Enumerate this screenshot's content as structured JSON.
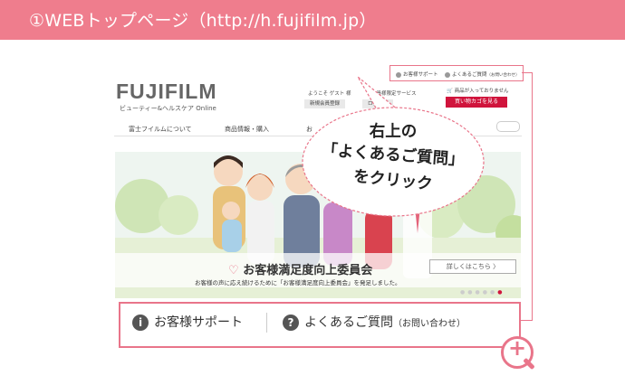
{
  "header": {
    "title": "①WEBトップページ（http://h.fujifilm.jp）"
  },
  "site": {
    "logo": "FUJIFILM",
    "logo_sub": "ビューティー&ヘルスケア Online",
    "util_support": "お客様サポート",
    "util_faq": "よくあるご質問",
    "util_faq_small": "（お問い合わせ）",
    "welcome": "ようこそ ゲスト 様",
    "member_service": "会員様限定サービス",
    "register": "新規会員登録",
    "login": "ログイン",
    "cart_status": "商品が入っておりません",
    "cart_button": "買い物カゴを見る"
  },
  "nav": {
    "items": [
      "富士フイルムについて",
      "商品情報・購入",
      "お"
    ]
  },
  "banner": {
    "title": "お客様満足度向上委員会",
    "subtitle": "お客様の声に応え続けるために「お客様満足度向上委員会」を発足しました。",
    "detail_button": "詳しくはこちら"
  },
  "callout": {
    "lines": [
      "右上の",
      "「よくあるご質問」",
      "をクリック"
    ]
  },
  "highlight": {
    "support_label": "お客様サポート",
    "faq_label": "よくあるご質問",
    "faq_small": "（お問い合わせ）"
  },
  "colors": {
    "accent": "#ef7d8d",
    "red": "#d0143c"
  }
}
